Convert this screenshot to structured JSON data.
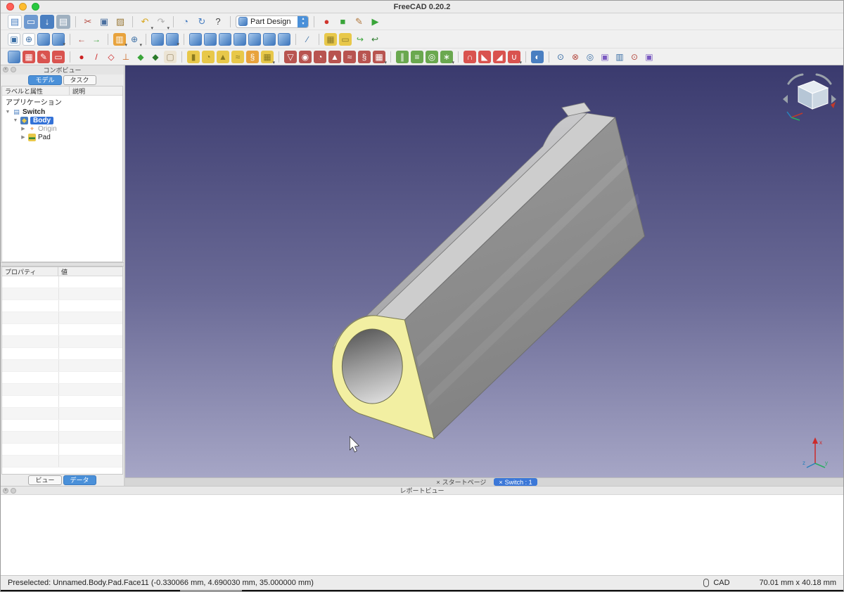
{
  "window": {
    "title": "FreeCAD 0.20.2"
  },
  "toolbars": {
    "workbench_label": "Part Design",
    "file": [
      {
        "n": "new-document",
        "g": "▤",
        "bg": "#ffffff",
        "fg": "#4a7fc1",
        "cls": "bordered"
      },
      {
        "n": "open-folder",
        "g": "▭",
        "bg": "#6f9ad0",
        "fg": "#ffffff"
      },
      {
        "n": "save",
        "g": "↓",
        "bg": "#4a7fc1",
        "fg": "#ffffff"
      },
      {
        "n": "print",
        "g": "▤",
        "bg": "#9fb0c0",
        "fg": "#ffffff"
      },
      {
        "sep": true
      },
      {
        "n": "cut",
        "g": "✂",
        "fg": "#b5493f"
      },
      {
        "n": "copy",
        "g": "▣",
        "fg": "#4a6f9f"
      },
      {
        "n": "paste",
        "g": "▨",
        "fg": "#9a7a3a"
      },
      {
        "sep": true
      },
      {
        "n": "undo",
        "g": "↶",
        "fg": "#d9a821",
        "caret": true
      },
      {
        "n": "redo",
        "g": "↷",
        "fg": "#b0b0b0",
        "caret": true
      },
      {
        "sep": true
      },
      {
        "n": "stopwatch",
        "g": "◔",
        "fg": "#4a7fc1"
      },
      {
        "n": "refresh",
        "g": "↻",
        "fg": "#4a7fc1"
      },
      {
        "n": "whats-this",
        "g": "?",
        "fg": "#444444"
      }
    ],
    "macro": [
      {
        "n": "macro-record",
        "g": "●",
        "fg": "#d0342c"
      },
      {
        "n": "macro-stop",
        "g": "■",
        "fg": "#3aa53a"
      },
      {
        "n": "macro-edit",
        "g": "✎",
        "fg": "#b0763a"
      },
      {
        "n": "macro-execute",
        "g": "▶",
        "fg": "#3aa53a"
      }
    ],
    "view": [
      {
        "n": "fit-all",
        "g": "▣",
        "fg": "#3a6ea5",
        "cls": "bordered"
      },
      {
        "n": "fit-selection",
        "g": "⊕",
        "fg": "#3a6ea5",
        "cls": "bordered"
      },
      {
        "n": "sync-view",
        "cls": "cube"
      },
      {
        "n": "draw-style",
        "cls": "cube",
        "caret": true
      },
      {
        "sep": true
      },
      {
        "n": "nav-back",
        "g": "←",
        "fg": "#b5493f"
      },
      {
        "n": "nav-forward",
        "g": "→",
        "fg": "#3aa53a"
      },
      {
        "sep": true
      },
      {
        "n": "orthographic-view",
        "g": "▥",
        "bg": "#e8a33d",
        "fg": "#ffffff",
        "caret": true
      },
      {
        "n": "zoom",
        "g": "⊕",
        "fg": "#3a6ea5",
        "caret": true
      },
      {
        "sep": true
      },
      {
        "n": "view-fit",
        "cls": "cube"
      },
      {
        "n": "view-axonometric",
        "cls": "cube",
        "caret": true
      },
      {
        "sep": true
      },
      {
        "n": "view-front",
        "cls": "cube"
      },
      {
        "n": "view-top",
        "cls": "cube"
      },
      {
        "n": "view-right",
        "cls": "cube"
      },
      {
        "n": "view-rear",
        "cls": "cube"
      },
      {
        "n": "view-bottom",
        "cls": "cube"
      },
      {
        "n": "view-left",
        "cls": "cube"
      },
      {
        "n": "view-home",
        "cls": "cube"
      },
      {
        "sep": true
      },
      {
        "n": "measure-distance",
        "g": "∕",
        "fg": "#3a6ea5"
      },
      {
        "sep": true
      },
      {
        "n": "create-part",
        "g": "▦",
        "bg": "#e8c84a",
        "fg": "#8a7a2a"
      },
      {
        "n": "create-group",
        "g": "▭",
        "bg": "#e8c84a",
        "fg": "#8a7a2a"
      },
      {
        "n": "make-link",
        "g": "↪",
        "fg": "#3aa53a"
      },
      {
        "n": "make-sub-link",
        "g": "↩",
        "fg": "#2a7a2a"
      }
    ],
    "partdesign": [
      {
        "n": "create-body",
        "cls": "cube"
      },
      {
        "n": "create-sketch",
        "g": "▦",
        "bg": "#d9534f",
        "fg": "#ffffff"
      },
      {
        "n": "edit-sketch",
        "g": "✎",
        "bg": "#d9534f",
        "fg": "#ffffff"
      },
      {
        "n": "map-sketch",
        "g": "▭",
        "bg": "#d9534f",
        "fg": "#ffffff"
      },
      {
        "sep": true
      },
      {
        "n": "datum-point",
        "g": "●",
        "fg": "#cc2222"
      },
      {
        "n": "datum-line",
        "g": "/",
        "fg": "#cc2222"
      },
      {
        "n": "datum-plane",
        "g": "◇",
        "fg": "#cc2222"
      },
      {
        "n": "local-coordinate-system",
        "g": "⊥",
        "fg": "#cc6622"
      },
      {
        "n": "shape-binder",
        "g": "◆",
        "fg": "#3aa53a"
      },
      {
        "n": "sub-shape-binder",
        "g": "◆",
        "fg": "#2a7a2a"
      },
      {
        "n": "clone",
        "g": "▢",
        "bg": "#ece4d4",
        "fg": "#9a8a6a"
      },
      {
        "sep": true
      },
      {
        "n": "pad",
        "g": "▮",
        "bg": "#e8c84a",
        "fg": "#8a7a20"
      },
      {
        "n": "revolution",
        "g": "◔",
        "bg": "#e8c84a",
        "fg": "#8a7a20"
      },
      {
        "n": "additive-loft",
        "g": "▲",
        "bg": "#e8c84a",
        "fg": "#8a7a20"
      },
      {
        "n": "additive-pipe",
        "g": "≈",
        "bg": "#e8c84a",
        "fg": "#8a7a20"
      },
      {
        "n": "additive-helix",
        "g": "§",
        "bg": "#e8a33d",
        "fg": "#ffffff"
      },
      {
        "n": "additive-primitive",
        "g": "▦",
        "bg": "#e8c84a",
        "fg": "#8a7a20",
        "caret": true
      },
      {
        "sep": true
      },
      {
        "n": "pocket",
        "g": "▽",
        "bg": "#b85450",
        "fg": "#ffffff"
      },
      {
        "n": "hole",
        "g": "◉",
        "bg": "#b85450",
        "fg": "#ffffff"
      },
      {
        "n": "groove",
        "g": "◔",
        "bg": "#b85450",
        "fg": "#ffffff"
      },
      {
        "n": "subtractive-loft",
        "g": "▲",
        "bg": "#b85450",
        "fg": "#ffffff"
      },
      {
        "n": "subtractive-pipe",
        "g": "≈",
        "bg": "#b85450",
        "fg": "#ffffff"
      },
      {
        "n": "subtractive-helix",
        "g": "§",
        "bg": "#b85450",
        "fg": "#ffffff"
      },
      {
        "n": "subtractive-primitive",
        "g": "▦",
        "bg": "#b85450",
        "fg": "#ffffff",
        "caret": true
      },
      {
        "sep": true
      },
      {
        "n": "mirrored",
        "g": "∥",
        "bg": "#6aa84f",
        "fg": "#ffffff"
      },
      {
        "n": "linear-pattern",
        "g": "≡",
        "bg": "#6aa84f",
        "fg": "#ffffff"
      },
      {
        "n": "polar-pattern",
        "g": "◎",
        "bg": "#6aa84f",
        "fg": "#ffffff"
      },
      {
        "n": "multi-transform",
        "g": "∗",
        "bg": "#6aa84f",
        "fg": "#ffffff",
        "caret": true
      },
      {
        "sep": true
      },
      {
        "n": "fillet",
        "g": "∩",
        "bg": "#d9534f",
        "fg": "#ffffff"
      },
      {
        "n": "chamfer",
        "g": "◣",
        "bg": "#d9534f",
        "fg": "#ffffff"
      },
      {
        "n": "draft",
        "g": "◢",
        "bg": "#d9534f",
        "fg": "#ffffff"
      },
      {
        "n": "thickness",
        "g": "∪",
        "bg": "#d9534f",
        "fg": "#ffffff",
        "caret": true
      },
      {
        "sep": true
      },
      {
        "n": "boolean-operation",
        "g": "◐",
        "bg": "#4a7fc1",
        "fg": "#ffffff"
      },
      {
        "sep": true
      },
      {
        "n": "check-geometry",
        "g": "⊙",
        "fg": "#3a6ea5"
      },
      {
        "n": "defeaturing",
        "g": "⊗",
        "fg": "#b5493f"
      },
      {
        "n": "refine-shape",
        "g": "◎",
        "fg": "#3a6ea5"
      },
      {
        "n": "convert-to-solid",
        "g": "▣",
        "fg": "#7a5ac1"
      },
      {
        "n": "section-view",
        "g": "▥",
        "fg": "#3a6ea5"
      },
      {
        "n": "sketch-validate",
        "g": "⊙",
        "fg": "#b5493f"
      },
      {
        "n": "parametric-frame",
        "g": "▣",
        "fg": "#7a5ac1"
      }
    ]
  },
  "combo_view": {
    "title": "コンボビュー",
    "tabs": [
      {
        "label": "モデル",
        "active": true
      },
      {
        "label": "タスク",
        "active": false
      }
    ],
    "columns": [
      "ラベルと属性",
      "説明"
    ],
    "tree": {
      "root_label": "アプリケーション",
      "items": [
        {
          "label": "Switch",
          "depth": 0,
          "exp": "▼",
          "ig": "▤",
          "ibg": "#ffffff",
          "ifg": "#4a7fc1",
          "bold": true
        },
        {
          "label": "Body",
          "depth": 1,
          "exp": "▼",
          "ig": "◆",
          "ibg": "#4a7fc1",
          "ifg": "#e8c84a",
          "bold": true,
          "selected": true
        },
        {
          "label": "Origin",
          "depth": 2,
          "exp": "▶",
          "ig": "⌖",
          "ibg": "transparent",
          "ifg": "#e8883a",
          "muted": true
        },
        {
          "label": "Pad",
          "depth": 2,
          "exp": "▶",
          "ig": "▬",
          "ibg": "#e8c84a",
          "ifg": "#3a8a3a"
        }
      ]
    }
  },
  "property_panel": {
    "columns": [
      "プロパティ",
      "値"
    ],
    "empty_row_count": 16,
    "tabs": [
      {
        "label": "ビュー",
        "active": false
      },
      {
        "label": "データ",
        "active": true
      }
    ]
  },
  "mdi_tabs": [
    {
      "close": "×",
      "label": "スタートページ",
      "active": false
    },
    {
      "close": "×",
      "label": "Switch : 1",
      "active": true
    }
  ],
  "report_view": {
    "title": "レポートビュー"
  },
  "status_bar": {
    "preselect_text": "Preselected: Unnamed.Body.Pad.Face11 (-0.330066 mm, 4.690030 mm, 35.000000 mm)",
    "nav_style": "CAD",
    "dimensions": "70.01 mm x 40.18 mm"
  },
  "viewport": {
    "bg_top": "#3a3a6e",
    "bg_bottom": "#a6a6c6",
    "model_face_color": "#f2efa2",
    "model_body_color": "#8e8e8e"
  }
}
